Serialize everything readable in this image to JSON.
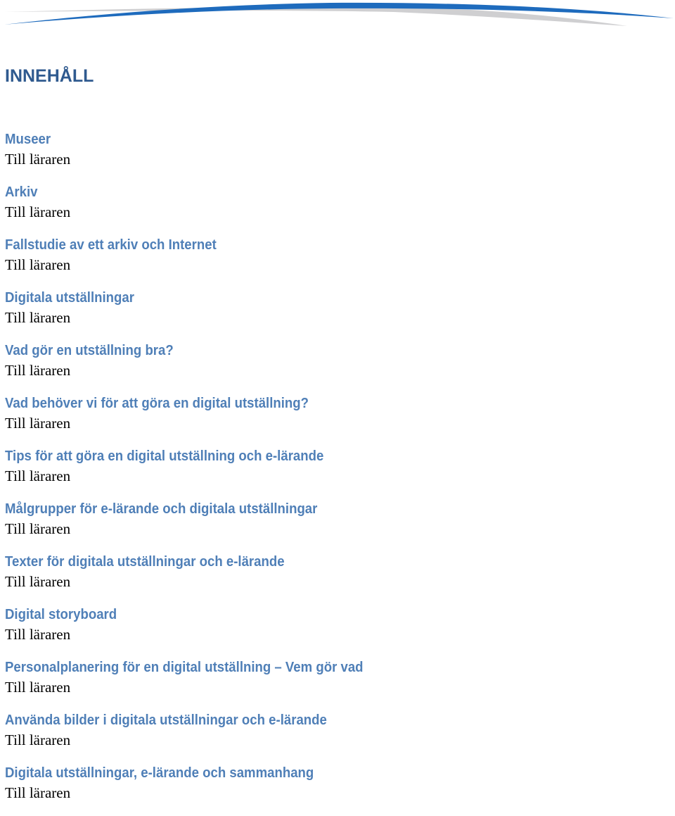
{
  "colors": {
    "title": "#2f5a8f",
    "heading": "#4f7fb7",
    "subtext": "#000000",
    "swoosh_blue": "#1e6bbd",
    "swoosh_gray": "#cfcfd1"
  },
  "header": {
    "decoration": "blue-gray-swoosh"
  },
  "toc": {
    "title": "INNEHÅLL",
    "entries": [
      {
        "heading": "Museer",
        "sub": "Till läraren"
      },
      {
        "heading": "Arkiv",
        "sub": "Till läraren"
      },
      {
        "heading": "Fallstudie av ett arkiv och Internet",
        "sub": "Till läraren"
      },
      {
        "heading": "Digitala utställningar",
        "sub": "Till läraren"
      },
      {
        "heading": "Vad gör en utställning bra?",
        "sub": "Till läraren"
      },
      {
        "heading": "Vad behöver vi för att göra en digital utställning?",
        "sub": "Till läraren"
      },
      {
        "heading": "Tips för att göra en digital utställning och e-lärande",
        "sub": "Till läraren"
      },
      {
        "heading": "Målgrupper för e-lärande och digitala utställningar",
        "sub": "Till läraren"
      },
      {
        "heading": "Texter för digitala utställningar och e-lärande",
        "sub": "Till läraren"
      },
      {
        "heading": "Digital storyboard",
        "sub": "Till läraren"
      },
      {
        "heading": "Personalplanering för en digital utställning – Vem gör vad",
        "sub": "Till läraren"
      },
      {
        "heading": "Använda bilder i digitala utställningar och e-lärande",
        "sub": "Till läraren"
      },
      {
        "heading": "Digitala utställningar, e-lärande och sammanhang",
        "sub": "Till läraren"
      }
    ]
  }
}
